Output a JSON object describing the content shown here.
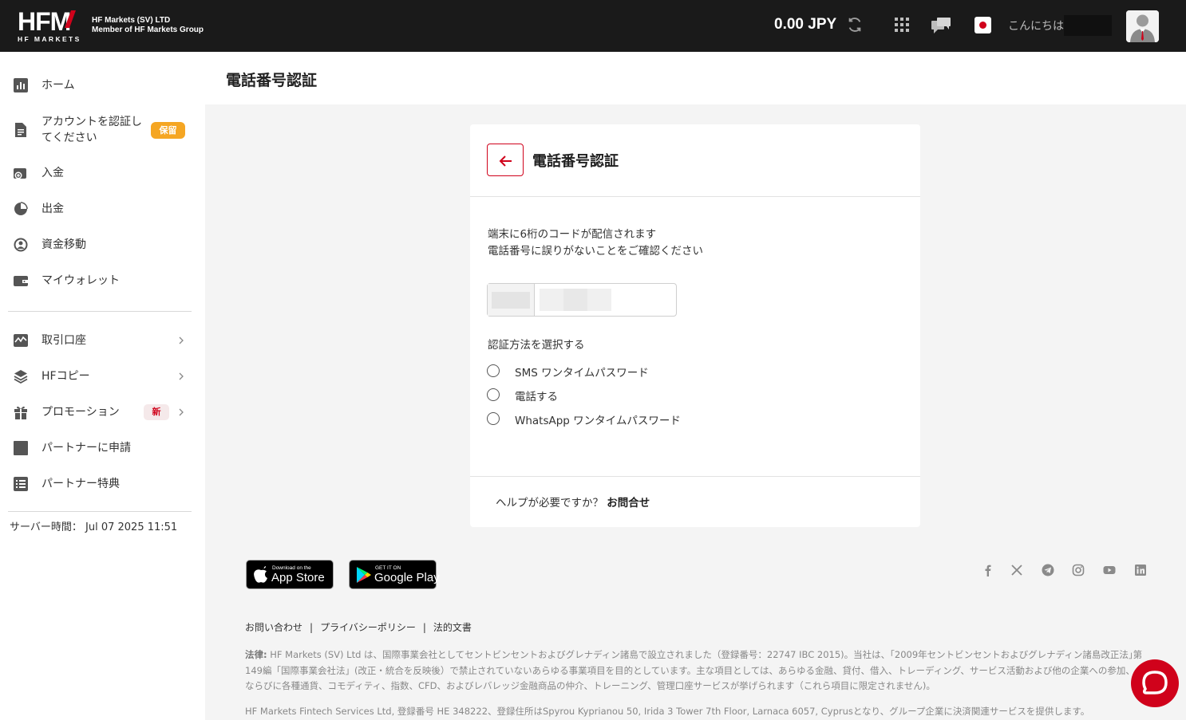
{
  "header": {
    "logo_text": "HFM",
    "logo_sub": "HF MARKETS",
    "company_line1": "HF Markets (SV) LTD",
    "company_line2": "Member of HF Markets Group",
    "balance": "0.00 JPY",
    "greeting": "こんにちは"
  },
  "sidebar": {
    "items": [
      {
        "label": "ホーム",
        "icon": "chart-icon"
      },
      {
        "label": "アカウントを認証し\nてください",
        "icon": "document-icon",
        "badge": "保留"
      },
      {
        "label": "入金",
        "icon": "deposit-icon"
      },
      {
        "label": "出金",
        "icon": "withdraw-icon"
      },
      {
        "label": "資金移動",
        "icon": "transfer-icon"
      },
      {
        "label": "マイウォレット",
        "icon": "wallet-icon"
      },
      {
        "label": "取引口座",
        "icon": "trading-icon"
      },
      {
        "label": "HFコピー",
        "icon": "layers-icon"
      },
      {
        "label": "プロモーション",
        "icon": "gift-icon",
        "badge": "新"
      },
      {
        "label": "パートナーに申請",
        "icon": "square-icon"
      },
      {
        "label": "パートナー特典",
        "icon": "list-icon"
      }
    ],
    "server_time_label": "サーバー時間：",
    "server_time": "Jul 07 2025 11:51"
  },
  "page": {
    "title": "電話番号認証"
  },
  "card": {
    "title": "電話番号認証",
    "info_line1": "端末に6桁のコードが配信されます",
    "info_line2": "電話番号に誤りがないことをご確認ください",
    "method_label": "認証方法を選択する",
    "methods": [
      "SMS ワンタイムパスワード",
      "電話する",
      "WhatsApp ワンタイムパスワード"
    ],
    "help_text": "ヘルプが必要ですか？",
    "help_link": "お問合せ"
  },
  "footer": {
    "appstore_small": "Download on the",
    "appstore_big": "App Store",
    "googleplay_small": "GET IT ON",
    "googleplay_big": "Google Play",
    "links": [
      "お問い合わせ",
      "プライバシーポリシー",
      "法的文書"
    ],
    "link_separator": "|",
    "legal_label": "法律:",
    "legal_text": "HF Markets (SV) Ltd は、国際事業会社としてセントビンセントおよびグレナディン諸島で設立されました（登録番号：22747 IBC 2015)。当社は、｢2009年セントビンセントおよびグレナディン諸島改正法｣第149編「国際事業会社法」(改正・統合を反映後）で禁止されていないあらゆる事業項目を目的としています。主な項目としては、あらゆる金融、貸付、借入、トレーディング、サービス活動および他の企業への参加、ならびに各種通貨、コモディティ、指数、CFD、およびレバレッジ金融商品の仲介、トレーニング、管理口座サービスが挙げられます（これら項目に限定されません)。",
    "legal_text2": "HF Markets Fintech Services Ltd, 登録番号 HE 348222、登録住所はSpyrou Kyprianou 50, Irida 3 Tower 7th Floor, Larnaca 6057, Cyprusとなり、グループ企業に決済関連サービスを提供します。"
  },
  "colors": {
    "brand_red": "#d0021b",
    "topbar": "#1a1a1a",
    "badge_hold": "#f5a623"
  }
}
